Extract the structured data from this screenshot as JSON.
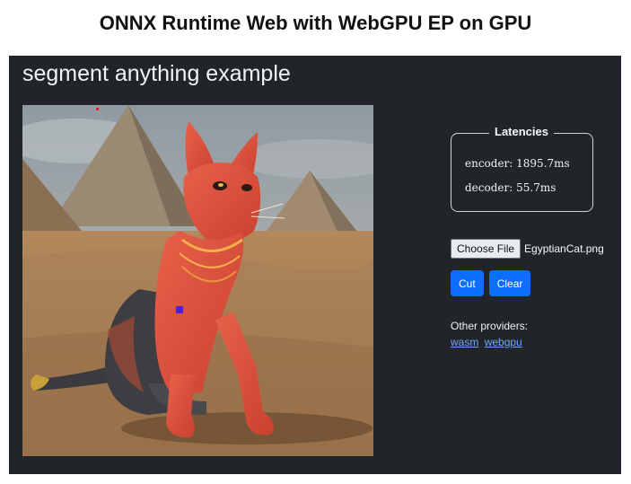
{
  "slide": {
    "title": "ONNX Runtime Web with WebGPU EP on GPU"
  },
  "app": {
    "title": "segment anything example",
    "canvas": {
      "image_name": "EgyptianCat.png"
    },
    "latencies": {
      "legend": "Latencies",
      "encoder": "encoder: 1895.7ms",
      "decoder": "decoder: 55.7ms"
    },
    "file_input": {
      "button_label": "Choose File",
      "file_name": "EgyptianCat.png"
    },
    "buttons": {
      "cut": "Cut",
      "clear": "Clear"
    },
    "providers": {
      "label": "Other providers:",
      "links": [
        "wasm",
        "webgpu"
      ]
    }
  },
  "colors": {
    "app_bg": "#212529",
    "accent_button": "#0d6efd",
    "link": "#6ea8fe",
    "mask_overlay": "#e0533f",
    "click_point": "#4b1fd6"
  }
}
